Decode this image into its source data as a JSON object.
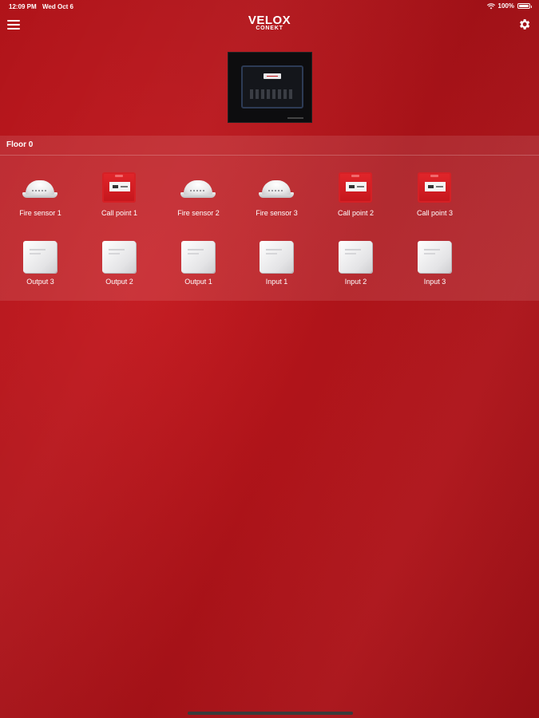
{
  "status_bar": {
    "time": "12:09 PM",
    "date": "Wed Oct 6",
    "battery": "100%",
    "battery_level": 1.0
  },
  "header": {
    "logo_main": "VELOX",
    "logo_sub": "CONEKT",
    "menu_icon": "hamburger-menu-icon",
    "settings_icon": "gear-icon"
  },
  "floor": {
    "title": "Floor 0",
    "rows": [
      [
        {
          "label": "Fire sensor 1",
          "type": "smoke"
        },
        {
          "label": "Call point 1",
          "type": "callpoint"
        },
        {
          "label": "Fire sensor 2",
          "type": "smoke"
        },
        {
          "label": "Fire sensor 3",
          "type": "smoke"
        },
        {
          "label": "Call point 2",
          "type": "callpoint"
        },
        {
          "label": "Call point 3",
          "type": "callpoint"
        }
      ],
      [
        {
          "label": "Output 3",
          "type": "module"
        },
        {
          "label": "Output 2",
          "type": "module"
        },
        {
          "label": "Output 1",
          "type": "module"
        },
        {
          "label": "Input 1",
          "type": "module"
        },
        {
          "label": "Input 2",
          "type": "module"
        },
        {
          "label": "Input 3",
          "type": "module"
        }
      ]
    ]
  },
  "colors": {
    "background": "#b3141a",
    "accent": "#c4161c"
  }
}
